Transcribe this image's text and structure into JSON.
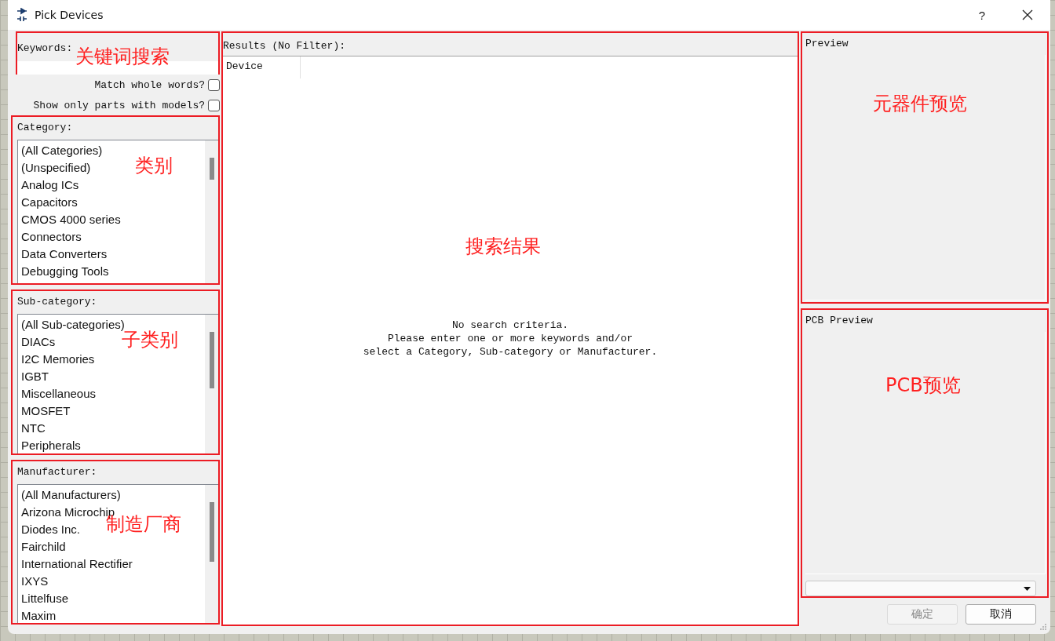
{
  "window": {
    "title": "Pick Devices",
    "help": "?"
  },
  "keywords": {
    "label": "Keywords:",
    "annotation": "关键词搜索"
  },
  "options": [
    {
      "label": "Match whole words?",
      "checked": false
    },
    {
      "label": "Show only parts with models?",
      "checked": false
    }
  ],
  "filters": [
    {
      "label": "Category:",
      "annotation": "类别",
      "items": [
        "(All Categories)",
        "(Unspecified)",
        "Analog ICs",
        "Capacitors",
        "CMOS 4000 series",
        "Connectors",
        "Data Converters",
        "Debugging Tools"
      ]
    },
    {
      "label": "Sub-category:",
      "annotation": "子类别",
      "items": [
        "(All Sub-categories)",
        "DIACs",
        "I2C Memories",
        "IGBT",
        "Miscellaneous",
        "MOSFET",
        "NTC",
        "Peripherals"
      ]
    },
    {
      "label": "Manufacturer:",
      "annotation": "制造厂商",
      "items": [
        "(All Manufacturers)",
        "Arizona Microchip",
        "Diodes Inc.",
        "Fairchild",
        "International Rectifier",
        "IXYS",
        "Littelfuse",
        "Maxim"
      ]
    }
  ],
  "results": {
    "label": "Results (No Filter):",
    "annotation": "搜索结果",
    "columns": [
      "Device"
    ],
    "message": [
      "No search criteria.",
      "Please enter one or more keywords and/or",
      "select a Category, Sub-category or Manufacturer."
    ]
  },
  "preview": {
    "label": "Preview",
    "annotation": "元器件预览"
  },
  "pcb_preview": {
    "label": "PCB Preview",
    "annotation": "PCB预览"
  },
  "buttons": [
    {
      "label": "确定",
      "disabled": true
    },
    {
      "label": "取消",
      "disabled": false
    }
  ]
}
